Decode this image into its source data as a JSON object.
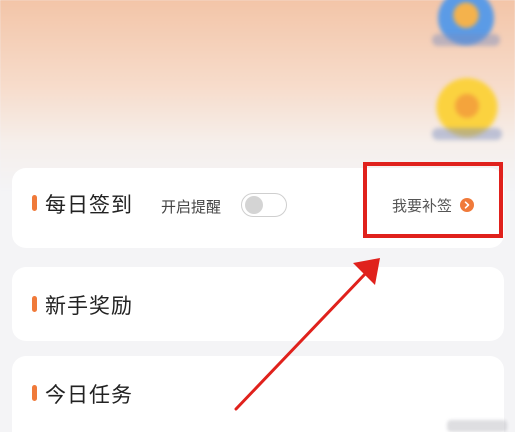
{
  "cards": {
    "checkin": {
      "title": "每日签到",
      "reminder_label": "开启提醒",
      "reminder_enabled": false,
      "makeup_label": "我要补签"
    },
    "newbie": {
      "title": "新手奖励"
    },
    "daily_tasks": {
      "title": "今日任务"
    }
  },
  "colors": {
    "accent": "#f07a3a",
    "annotation": "#e0211c",
    "card_background": "#ffffff",
    "page_background": "#f4f4f6"
  },
  "icons": {
    "makeup_chevron": "chevron-right-icon"
  }
}
